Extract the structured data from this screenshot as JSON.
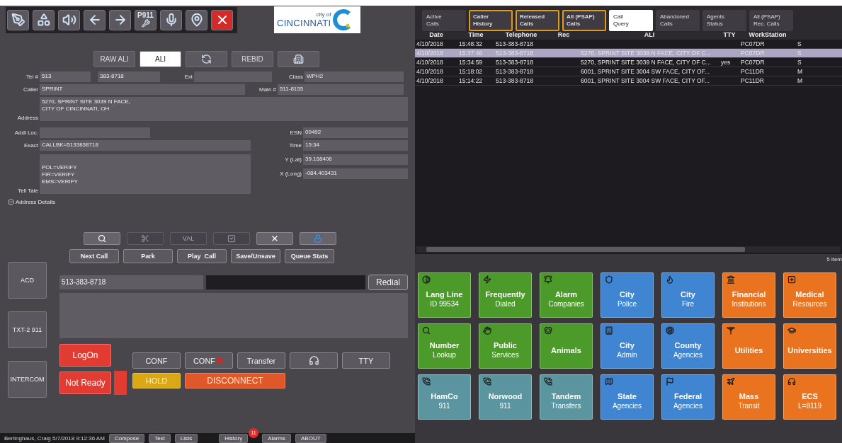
{
  "toolbar": {
    "p911": "P911",
    "logo": {
      "small": "city of",
      "name": "CINCINNATI"
    }
  },
  "ali_tabs": [
    {
      "kind": "text",
      "label": "RAW ALI",
      "selected": false
    },
    {
      "kind": "text",
      "label": "ALI",
      "selected": true
    },
    {
      "kind": "icon",
      "selected": false
    },
    {
      "kind": "text",
      "label": "REBID",
      "selected": false
    },
    {
      "kind": "icon",
      "selected": false
    }
  ],
  "ali": {
    "tel": {
      "label": "Tel #",
      "value": "513"
    },
    "tel_number": {
      "value": "383-8718"
    },
    "ext": {
      "label": "Ext"
    },
    "class": {
      "label": "Class",
      "value": "WPH2"
    },
    "caller": {
      "label": "Caller",
      "value": "SPRINT"
    },
    "main": {
      "label": "Main #",
      "value": "511-8155"
    },
    "address": {
      "label": "Address",
      "value": "5270, SPRINT SITE 3039 N FACE,\nCITY OF CINCINNATI, OH"
    },
    "addl_loc": {
      "label": "Addl Loc."
    },
    "esn": {
      "label": "ESN",
      "value": "00492"
    },
    "exact": {
      "label": "Exact",
      "value": "CALLBK=5133838718"
    },
    "time": {
      "label": "Time",
      "value": "15:34"
    },
    "tell_tale": {
      "label": "Tell Tale",
      "value": "POL=VERIFY\nFIR=VERIFY\nEMS=VERIFY"
    },
    "lat": {
      "label": "Y (Lat)",
      "value": "39.168406"
    },
    "long": {
      "label": "X (Long)",
      "value": "-084.403431"
    }
  },
  "address_details": {
    "label": "Address Details",
    "expanded": false
  },
  "ali_actions": [
    {
      "disabled": false
    },
    {
      "disabled": true
    },
    {
      "label": "VAL",
      "disabled": true
    },
    {
      "disabled": true
    },
    {
      "disabled": false
    },
    {
      "disabled": false
    }
  ],
  "call_buttons": [
    "Next Call",
    "Park",
    "Play  Call",
    "Save/Unsave",
    "Queue Stats"
  ],
  "side_buttons": [
    "ACD",
    "TXT-2 911",
    "INTERCOM"
  ],
  "dial": {
    "value": "513-383-8718",
    "button": "Redial"
  },
  "agent_buttons": [
    {
      "label": "LogOn"
    },
    {
      "label": "Not Ready"
    }
  ],
  "call_controls": [
    {
      "kind": "text",
      "label": "CONF"
    },
    {
      "kind": "cancel",
      "label": "CONF"
    },
    {
      "kind": "text",
      "label": "Transfer"
    },
    {
      "kind": "headset"
    },
    {
      "kind": "text",
      "label": "TTY"
    }
  ],
  "hold": "HOLD",
  "disconnect": "DISCONNECT",
  "status_bar": {
    "user": "Berlinghaus, Craig  5/7/2018 9:12:36 AM",
    "buttons": [
      {
        "label": "Compose"
      },
      {
        "label": "Text"
      },
      {
        "label": "Lists"
      },
      {
        "label": "History",
        "badge": "11"
      },
      {
        "label": "Alarms"
      },
      {
        "label": "ABOUT"
      }
    ]
  },
  "call_tabs": [
    {
      "lines": [
        "Active",
        "Calls"
      ],
      "selected": false,
      "outlined": false
    },
    {
      "lines": [
        "Caller",
        "History"
      ],
      "selected": false,
      "outlined": true
    },
    {
      "lines": [
        "Released",
        "Calls"
      ],
      "selected": false,
      "outlined": true
    },
    {
      "lines": [
        "All (PSAP)",
        "Calls"
      ],
      "selected": false,
      "outlined": true
    },
    {
      "lines": [
        "Call",
        "Query"
      ],
      "selected": true,
      "outlined": false
    },
    {
      "lines": [
        "Abandoned",
        "Calls"
      ],
      "selected": false,
      "outlined": false
    },
    {
      "lines": [
        "Agents",
        "Status"
      ],
      "selected": false,
      "outlined": false
    },
    {
      "lines": [
        "All (PSAP)",
        "Rec. Calls"
      ],
      "selected": false,
      "outlined": false
    }
  ],
  "table": {
    "columns": [
      "Date",
      "Time",
      "Telephone",
      "Rec",
      "ALI",
      "TTY",
      "WorkStation"
    ],
    "rows": [
      {
        "selected": false,
        "cells": [
          "4/10/2018",
          "15:48:32",
          "513-383-8718",
          "",
          "",
          "",
          "PC07DR",
          "S"
        ]
      },
      {
        "selected": true,
        "cells": [
          "4/10/2018",
          "15:37:46",
          "513-383-8718",
          "",
          "5270, SPRINT SITE 3039 N FACE, CITY OF C...",
          "",
          "PC07DR",
          "S"
        ]
      },
      {
        "selected": false,
        "cells": [
          "4/10/2018",
          "15:34:59",
          "513-383-8718",
          "",
          "5270, SPRINT SITE 3039 N FACE, CITY OF C...",
          "yes",
          "PC07DR",
          "S"
        ]
      },
      {
        "selected": false,
        "cells": [
          "4/10/2018",
          "15:18:02",
          "513-383-8718",
          "",
          "6001, SPRINT SITE 3004 SW FACE, CITY OF...",
          "",
          "PC11DR",
          "M"
        ]
      },
      {
        "selected": false,
        "cells": [
          "4/10/2018",
          "15:14:22",
          "513-383-8718",
          "",
          "6001, SPRINT SITE 3004 SW FACE, CITY OF...",
          "",
          "PC11DR",
          "M"
        ]
      }
    ],
    "footer": "5 item"
  },
  "speed_dials": [
    {
      "title": "Lang Line",
      "sub": "ID 99534",
      "color": "#4c9a2a"
    },
    {
      "title": "Frequently",
      "sub": "Dialed",
      "color": "#4c9a2a"
    },
    {
      "title": "Alarm",
      "sub": "Companies",
      "color": "#4c9a2a"
    },
    {
      "title": "City",
      "sub": "Police",
      "color": "#3f85d2"
    },
    {
      "title": "City",
      "sub": "Fire",
      "color": "#3f85d2"
    },
    {
      "title": "Financial",
      "sub": "Institutions",
      "color": "#ea7320"
    },
    {
      "title": "Medical",
      "sub": "Resources",
      "color": "#ea7320"
    },
    {
      "title": "Number",
      "sub": "Lookup",
      "color": "#4c9a2a"
    },
    {
      "title": "Public",
      "sub": "Services",
      "color": "#4c9a2a"
    },
    {
      "title": "Animals",
      "color": "#4c9a2a"
    },
    {
      "title": "City",
      "sub": "Admin",
      "color": "#3f85d2"
    },
    {
      "title": "County",
      "sub": "Agencies",
      "color": "#3f85d2"
    },
    {
      "title": "Utilities",
      "color": "#ea7320"
    },
    {
      "title": "Universities",
      "color": "#ea7320"
    },
    {
      "title": "HamCo",
      "sub": "911",
      "color": "#5b96a0"
    },
    {
      "title": "Norwood",
      "sub": "911",
      "color": "#5b96a0"
    },
    {
      "title": "Tandem",
      "sub": "Transfers",
      "color": "#5b96a0"
    },
    {
      "title": "State",
      "sub": "Agencies",
      "color": "#3f85d2"
    },
    {
      "title": "Federal",
      "sub": "Agencies",
      "color": "#3f85d2"
    },
    {
      "title": "Mass",
      "sub": "Transit",
      "color": "#ea7320"
    },
    {
      "title": "ECS",
      "sub": "L=8119",
      "color": "#ea7320"
    }
  ]
}
